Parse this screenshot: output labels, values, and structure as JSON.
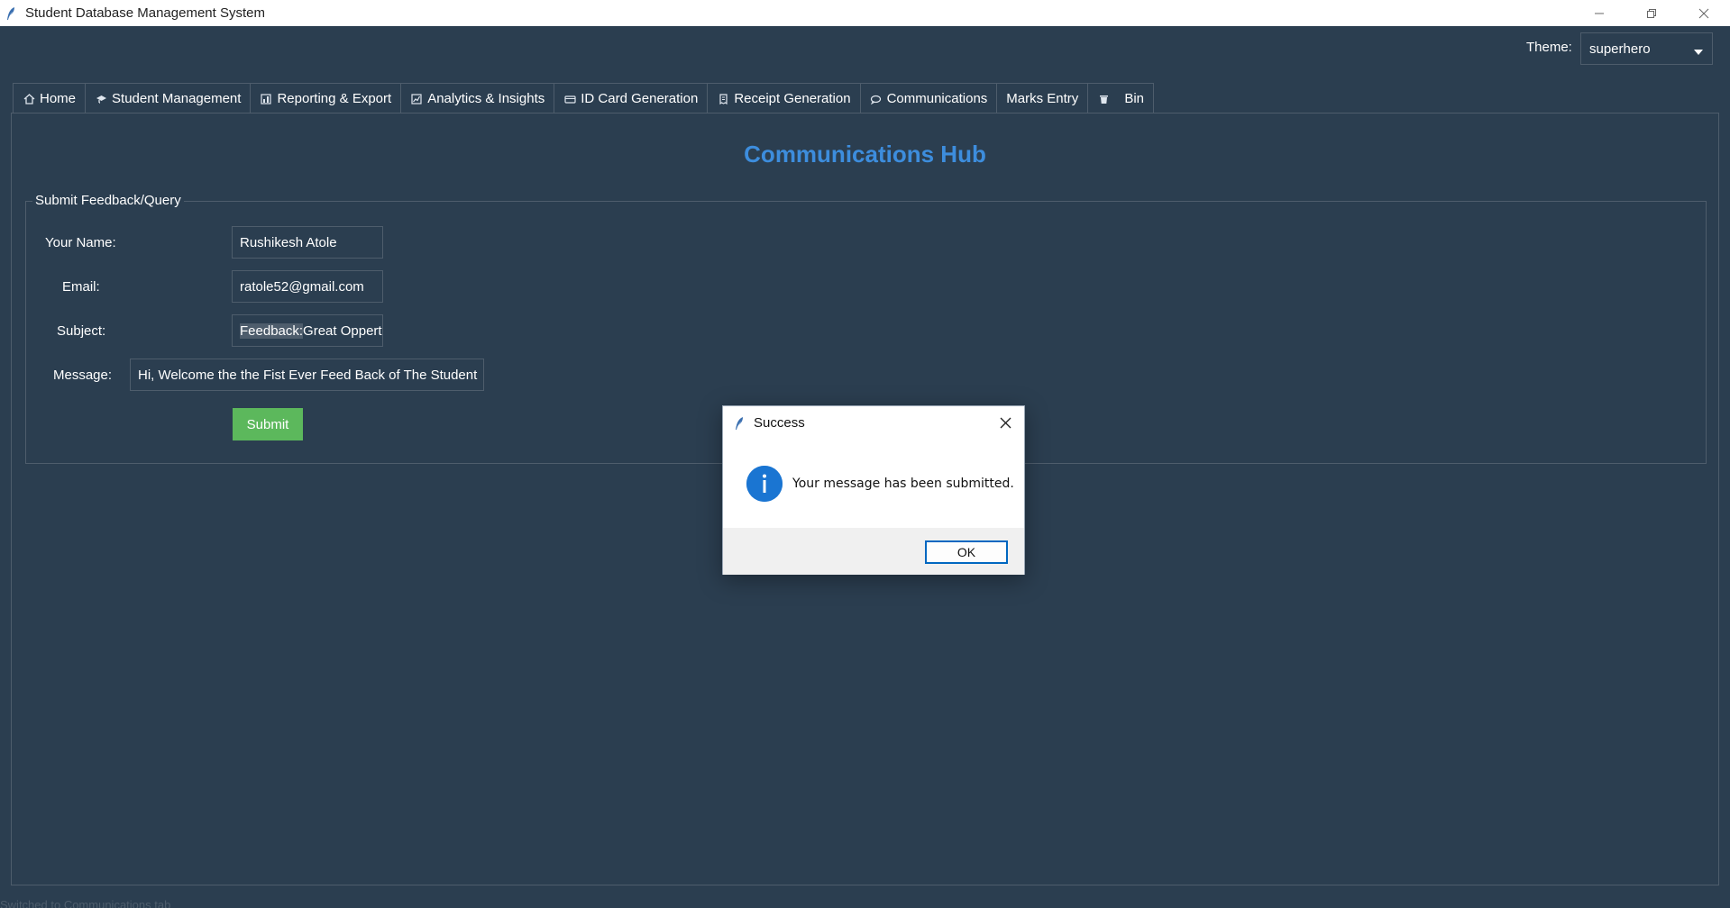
{
  "window": {
    "title": "Student Database Management System",
    "controls": [
      "minimize",
      "restore",
      "close"
    ]
  },
  "theme": {
    "label": "Theme:",
    "value": "superhero"
  },
  "tabs": [
    {
      "label": "Home",
      "icon": "home-icon"
    },
    {
      "label": "Student Management",
      "icon": "graduation-cap-icon"
    },
    {
      "label": "Reporting & Export",
      "icon": "bar-chart-icon"
    },
    {
      "label": "Analytics & Insights",
      "icon": "chart-icon"
    },
    {
      "label": "ID Card Generation",
      "icon": "id-card-icon"
    },
    {
      "label": "Receipt Generation",
      "icon": "receipt-icon"
    },
    {
      "label": "Communications",
      "icon": "speech-bubble-icon",
      "active": true
    },
    {
      "label": "Marks Entry",
      "icon": ""
    },
    {
      "label": "Bin",
      "icon": "trash-icon"
    }
  ],
  "main": {
    "title": "Communications Hub",
    "form": {
      "legend": "Submit Feedback/Query",
      "name_label": "Your Name:",
      "name_value": "Rushikesh Atole",
      "email_label": "Email:",
      "email_value": "ratole52@gmail.com",
      "subject_label": "Subject:",
      "subject_selected": "Feedback:",
      "subject_rest": "Great Oppert",
      "message_label": "Message:",
      "message_value": "Hi, Welcome the the Fist Ever Feed Back of The Student",
      "submit_label": "Submit"
    }
  },
  "status": "Switched to  Communications tab",
  "dialog": {
    "title": "Success",
    "message": "Your message has been submitted.",
    "ok_label": "OK",
    "icon": "info-icon"
  },
  "colors": {
    "background": "#2b3e50",
    "accent_title": "#3d8ddd",
    "submit": "#5cb85c",
    "border": "#4e5d6c"
  }
}
